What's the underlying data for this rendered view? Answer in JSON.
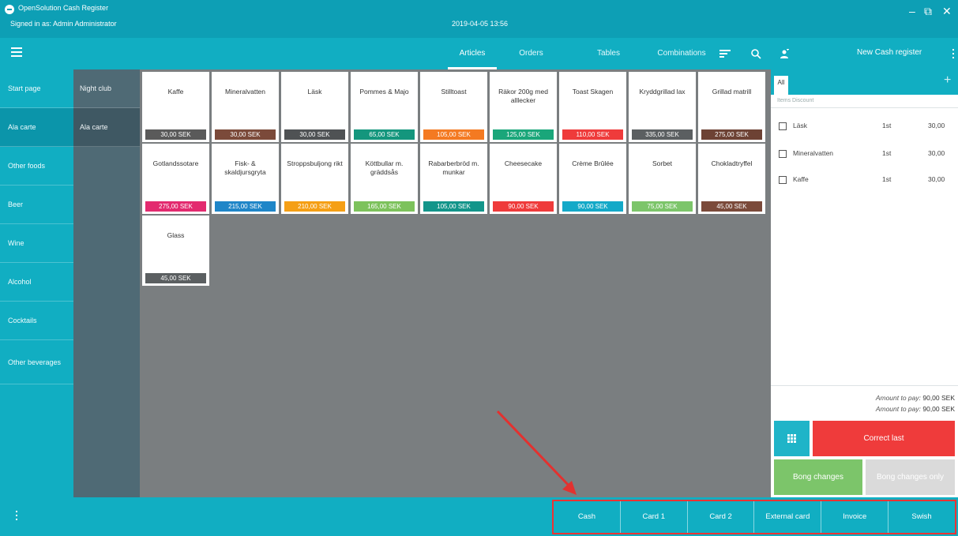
{
  "titlebar": {
    "app_title": "OpenSolution Cash Register",
    "signed_in": "Signed in as: Admin Administrator",
    "datetime": "2019-04-05 13:56",
    "minimize": "–",
    "restore": "⧉",
    "close": "✕"
  },
  "nav": {
    "tabs": [
      "Articles",
      "Orders",
      "Tables",
      "Combinations"
    ],
    "active_tab": "Articles",
    "register_label": "New Cash register"
  },
  "categories": [
    "Start page",
    "Ala carte",
    "Other foods",
    "Beer",
    "Wine",
    "Alcohol",
    "Cocktails",
    "Other beverages"
  ],
  "subcategories": [
    "Night club",
    "Ala carte"
  ],
  "articles": [
    {
      "name": "Kaffe",
      "price": "30,00 SEK",
      "color": "#5a5a5a"
    },
    {
      "name": "Mineralvatten",
      "price": "30,00 SEK",
      "color": "#7b4a3a"
    },
    {
      "name": "Läsk",
      "price": "30,00 SEK",
      "color": "#4f5254"
    },
    {
      "name": "Pommes & Majo",
      "price": "65,00 SEK",
      "color": "#14967d"
    },
    {
      "name": "Stilltoast",
      "price": "105,00 SEK",
      "color": "#f47a22"
    },
    {
      "name": "Räkor 200g med alllecker",
      "price": "125,00 SEK",
      "color": "#1aa67a"
    },
    {
      "name": "Toast Skagen",
      "price": "110,00 SEK",
      "color": "#ef3b3b"
    },
    {
      "name": "Kryddgrillad lax",
      "price": "335,00 SEK",
      "color": "#5b5f61"
    },
    {
      "name": "Grillad matrill",
      "price": "275,00 SEK",
      "color": "#6d4234"
    },
    {
      "name": "Gotlandssotare",
      "price": "275,00 SEK",
      "color": "#e32a6f"
    },
    {
      "name": "Fisk- & skaldjursgryta",
      "price": "215,00 SEK",
      "color": "#1f86c8"
    },
    {
      "name": "Stroppsbuljong rikt",
      "price": "210,00 SEK",
      "color": "#f59f15"
    },
    {
      "name": "Köttbullar m. gräddsås",
      "price": "165,00 SEK",
      "color": "#7dc25c"
    },
    {
      "name": "Rabarberbröd m. munkar",
      "price": "105,00 SEK",
      "color": "#13958a"
    },
    {
      "name": "Cheesecake",
      "price": "90,00 SEK",
      "color": "#ef3b3b"
    },
    {
      "name": "Crème Brûlée",
      "price": "90,00 SEK",
      "color": "#14a9c8"
    },
    {
      "name": "Sorbet",
      "price": "75,00 SEK",
      "color": "#7cc56a"
    },
    {
      "name": "Chokladtryffel",
      "price": "45,00 SEK",
      "color": "#7b4a3a"
    },
    {
      "name": "Glass",
      "price": "45,00 SEK",
      "color": "#5b5f61"
    }
  ],
  "order": {
    "tab_label": "All",
    "columns": "Items  Discount",
    "lines": [
      {
        "name": "Läsk",
        "qty": "1st",
        "amount": "30,00"
      },
      {
        "name": "Mineralvatten",
        "qty": "1st",
        "amount": "30,00"
      },
      {
        "name": "Kaffe",
        "qty": "1st",
        "amount": "30,00"
      }
    ],
    "amount_to_pay_label": "Amount to pay:",
    "amount_to_pay": "90,00 SEK",
    "amount_to_pay2_label": "Amount to pay:",
    "amount_to_pay2": "90,00 SEK",
    "correct_last": "Correct last",
    "bong_changes": "Bong changes",
    "bong_changes_only": "Bong changes only"
  },
  "payments": [
    "Cash",
    "Card 1",
    "Card 2",
    "External card",
    "Invoice",
    "Swish"
  ]
}
